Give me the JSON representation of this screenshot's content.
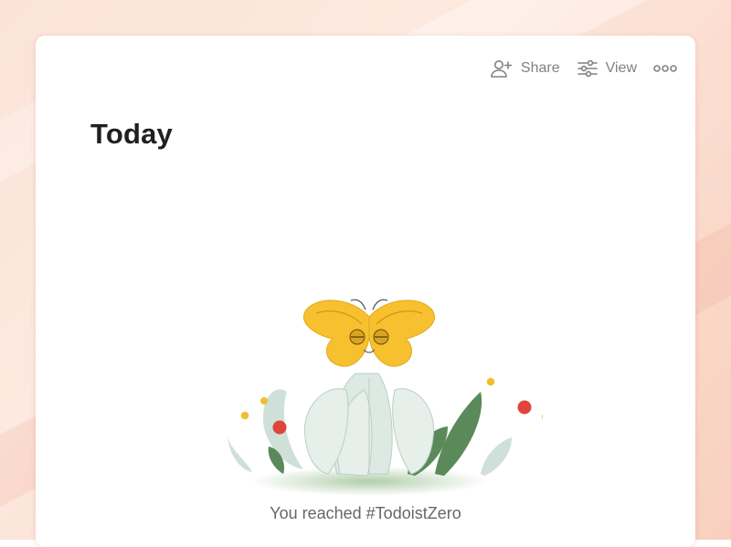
{
  "toolbar": {
    "share_label": "Share",
    "share_icon": "add-person-icon",
    "view_label": "View",
    "view_icon": "sliders-icon",
    "more_icon": "more-dots-icon"
  },
  "page": {
    "title": "Today"
  },
  "empty_state": {
    "message": "You reached #TodoistZero",
    "illustration": "person-with-butterfly-illustration"
  },
  "colors": {
    "background": "#fbe3d8",
    "window": "#ffffff",
    "title_text": "#202020",
    "toolbar_text": "#808080",
    "butterfly": "#f7c02e",
    "leaf_dark": "#5a8a5a",
    "leaf_light": "#cfe0d8",
    "dot_red": "#e0443a",
    "dot_yellow": "#f2be2d"
  }
}
